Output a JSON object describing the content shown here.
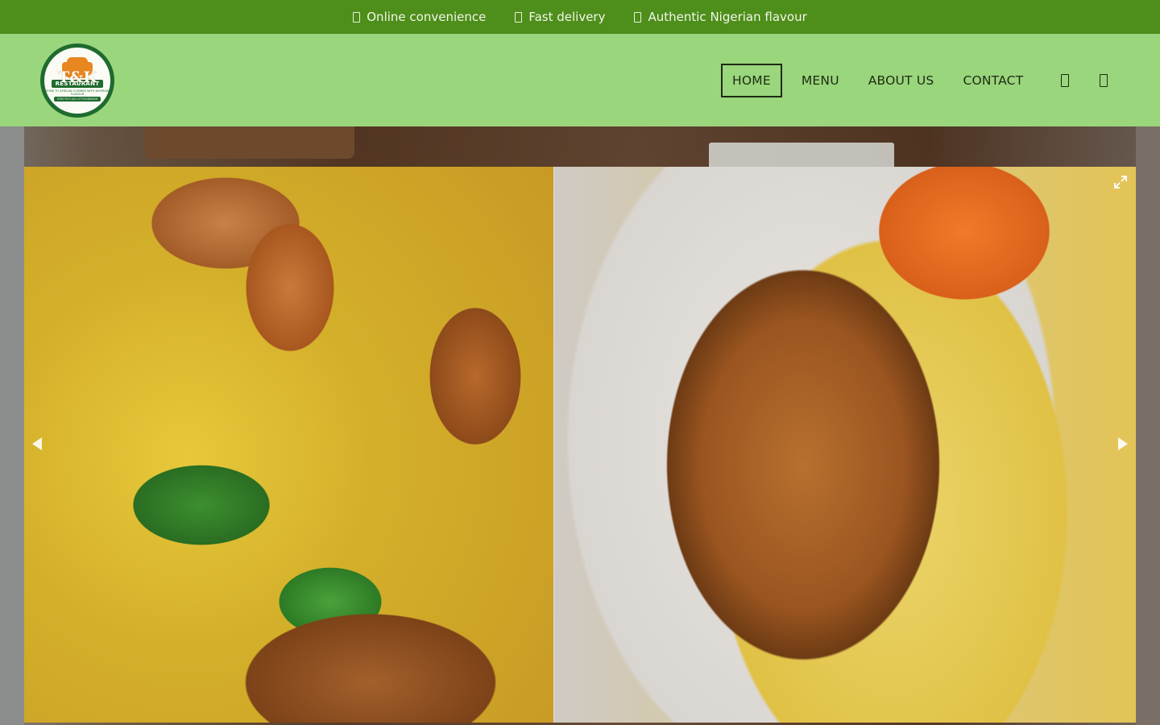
{
  "topbar": {
    "features": [
      {
        "label": "Online convenience",
        "icon": "laptop-icon"
      },
      {
        "label": "Fast delivery",
        "icon": "truck-icon"
      },
      {
        "label": "Authentic Nigerian flavour",
        "icon": "utensils-icon"
      }
    ]
  },
  "header": {
    "logo": {
      "brand": "T&K",
      "band": "RESTAURANT",
      "tagline": "HOME TO AFRICAN CUISINES WITH NIGERIAN FLAVOUR",
      "phone": "07877071421 07744382659"
    },
    "nav": [
      {
        "label": "HOME",
        "active": true
      },
      {
        "label": "MENU",
        "active": false
      },
      {
        "label": "ABOUT US",
        "active": false
      },
      {
        "label": "CONTACT",
        "active": false
      }
    ],
    "icons": [
      "search-icon",
      "cart-icon"
    ]
  },
  "hero": {
    "slider": {
      "slides": [
        "jollof rice with chicken and mint",
        "fried rice with chicken and vegetables"
      ],
      "controls": [
        "prev-arrow",
        "next-arrow",
        "fullscreen"
      ]
    }
  },
  "colors": {
    "topbar_bg": "#4e8e1a",
    "header_bg": "#9ad67c",
    "logo_green": "#1e6b2e",
    "logo_orange": "#e8861f"
  }
}
